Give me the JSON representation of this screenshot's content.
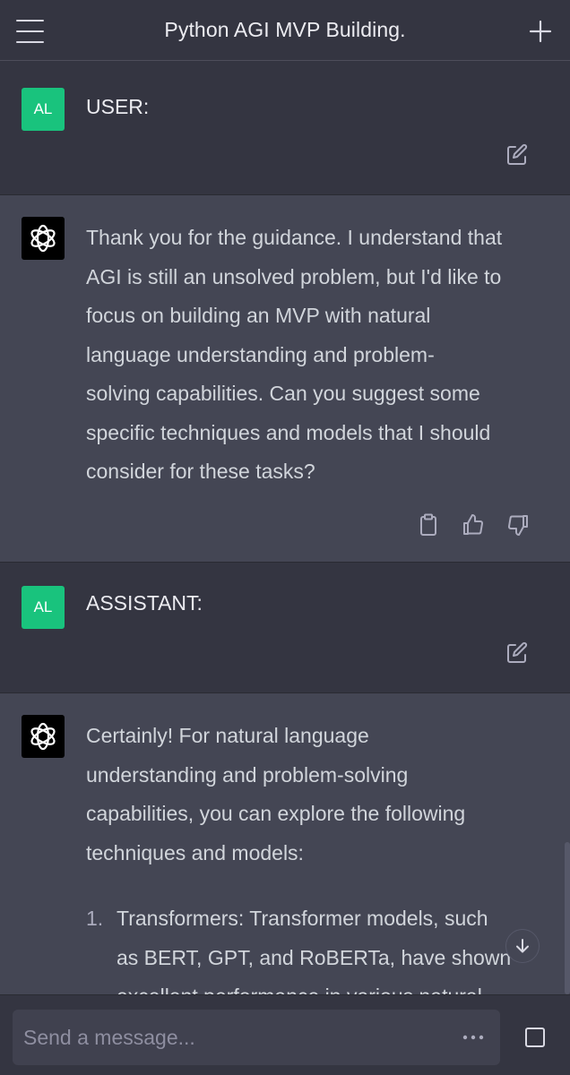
{
  "header": {
    "title": "Python AGI MVP Building."
  },
  "messages": [
    {
      "role": "user",
      "avatar_initials": "AL",
      "text": "USER:"
    },
    {
      "role": "assistant",
      "text_lines": [
        "Thank you for the guidance. I understand that",
        "AGI is still an unsolved problem, but I'd like to",
        "focus on building an MVP with natural",
        "language understanding and problem-",
        "solving capabilities. Can you suggest some",
        "specific techniques and models that I should",
        "consider for these tasks?"
      ]
    },
    {
      "role": "user",
      "avatar_initials": "AL",
      "text": "ASSISTANT:"
    },
    {
      "role": "assistant",
      "text_lines": [
        "Certainly! For natural language",
        "understanding and problem-solving",
        "capabilities, you can explore the following",
        "techniques and models:"
      ],
      "list": [
        {
          "number": "1.",
          "lines": [
            "Transformers: Transformer models, such",
            "as BERT, GPT, and RoBERTa, have shown",
            "excellent performance in various natural"
          ]
        }
      ]
    }
  ],
  "composer": {
    "placeholder": "Send a message...",
    "more_label": "..."
  },
  "icons": {
    "menu": "hamburger-icon",
    "new_chat": "plus-icon",
    "edit": "edit-icon",
    "copy": "clipboard-icon",
    "like": "thumbs-up-icon",
    "dislike": "thumbs-down-icon",
    "scroll": "arrow-down-icon",
    "stop": "stop-icon"
  },
  "colors": {
    "user_avatar": "#19c37d",
    "bot_bg": "#444654",
    "user_bg": "#343541"
  }
}
